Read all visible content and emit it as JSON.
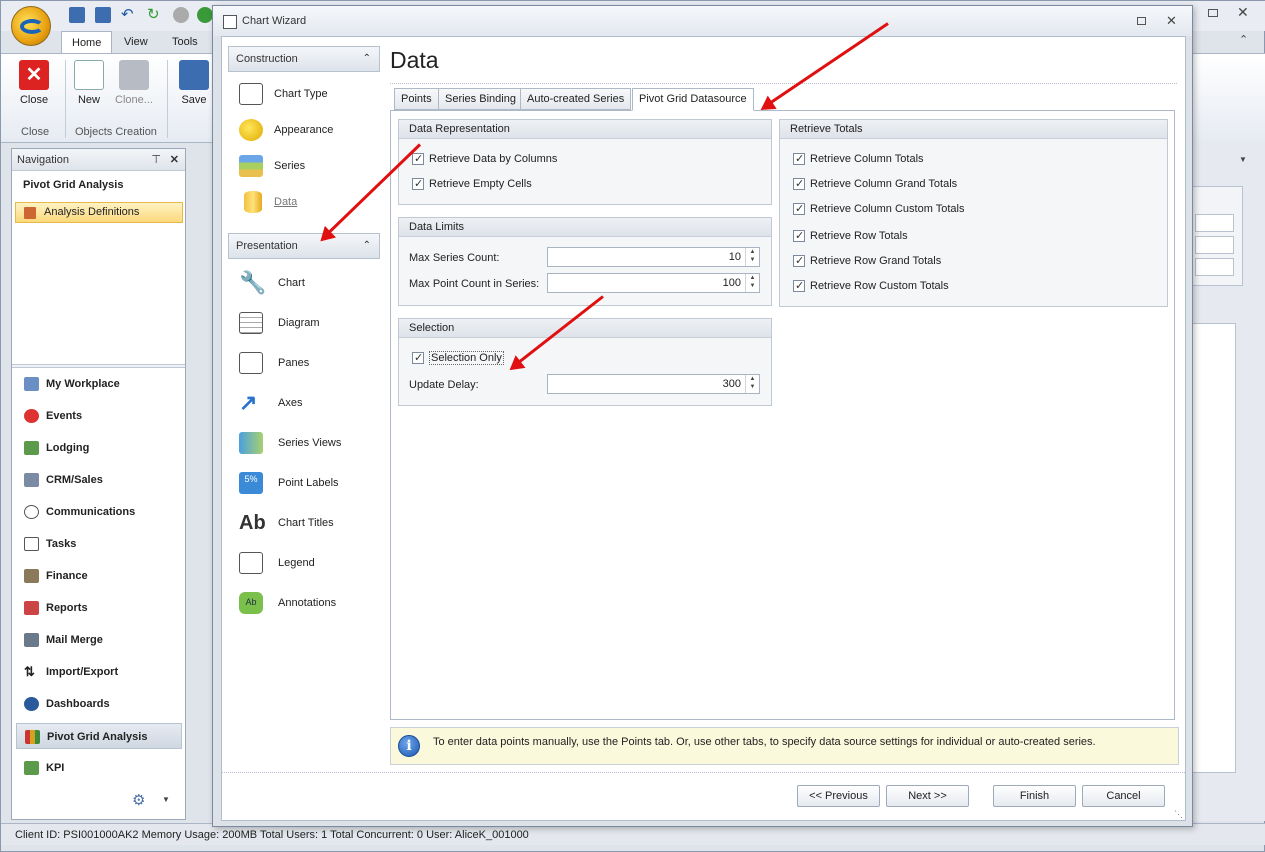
{
  "app": {
    "tabs": [
      "Home",
      "View",
      "Tools"
    ],
    "ribbon": {
      "close_label": "Close",
      "new_label": "New",
      "clone_label": "Clone...",
      "save_label": "Save",
      "group_close": "Close",
      "group_objects": "Objects Creation"
    },
    "navigation": {
      "header": "Navigation",
      "title": "Pivot Grid Analysis",
      "selected_item": "Analysis Definitions",
      "items": [
        "My Workplace",
        "Events",
        "Lodging",
        "CRM/Sales",
        "Communications",
        "Tasks",
        "Finance",
        "Reports",
        "Mail Merge",
        "Import/Export",
        "Dashboards",
        "Pivot Grid Analysis",
        "KPI"
      ],
      "selected_nav": "Pivot Grid Analysis"
    },
    "status_bar": "Client ID: PSI001000AK2   Memory Usage: 200MB   Total Users: 1   Total Concurrent: 0   User: AliceK_001000"
  },
  "wizard": {
    "title": "Chart Wizard",
    "construction_header": "Construction",
    "construction_items": [
      "Chart Type",
      "Appearance",
      "Series",
      "Data"
    ],
    "presentation_header": "Presentation",
    "presentation_items": [
      "Chart",
      "Diagram",
      "Panes",
      "Axes",
      "Series Views",
      "Point Labels",
      "Chart Titles",
      "Legend",
      "Annotations"
    ],
    "page_title": "Data",
    "tabs": [
      "Points",
      "Series Binding",
      "Auto-created Series",
      "Pivot Grid Datasource"
    ],
    "active_tab": "Pivot Grid Datasource",
    "data_representation": {
      "header": "Data Representation",
      "retrieve_by_columns": "Retrieve Data by Columns",
      "retrieve_empty_cells": "Retrieve Empty Cells"
    },
    "data_limits": {
      "header": "Data Limits",
      "max_series_label": "Max Series Count:",
      "max_series_value": "10",
      "max_points_label": "Max Point Count in Series:",
      "max_points_value": "100"
    },
    "selection": {
      "header": "Selection",
      "selection_only": "Selection Only",
      "update_delay_label": "Update Delay:",
      "update_delay_value": "300"
    },
    "retrieve_totals": {
      "header": "Retrieve Totals",
      "items": [
        "Retrieve Column Totals",
        "Retrieve Column Grand Totals",
        "Retrieve Column Custom Totals",
        "Retrieve Row Totals",
        "Retrieve Row Grand Totals",
        "Retrieve Row Custom Totals"
      ]
    },
    "info_text": "To enter data points manually, use the Points tab. Or, use other tabs, to specify data source settings for individual or auto-created series.",
    "buttons": {
      "previous": "<< Previous",
      "next": "Next >>",
      "finish": "Finish",
      "cancel": "Cancel"
    }
  },
  "colors": {
    "annotation_arrow": "#e01010",
    "nav_selected": "#fbd97c",
    "info_bg": "#fbf9dc"
  }
}
